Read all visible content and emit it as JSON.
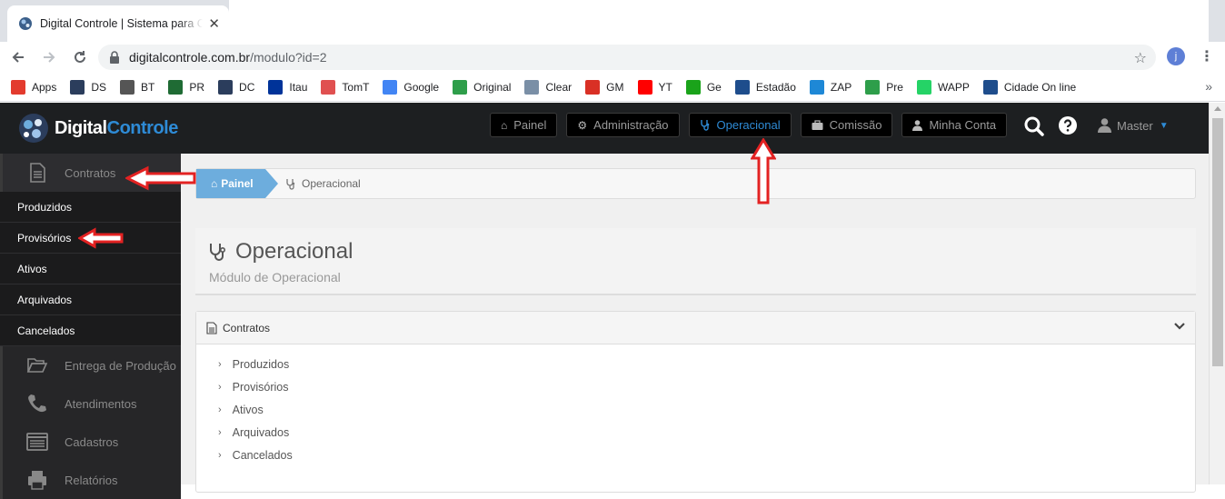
{
  "browser": {
    "tab_title": "Digital Controle | Sistema para Co",
    "tab_close": "✕",
    "url_host": "digitalcontrole.com.br",
    "url_path": "/modulo?id=2",
    "profile_initial": "j",
    "bookmarks": [
      {
        "label": "Apps",
        "icon": "apps-grid-icon",
        "color": "#e33b2e"
      },
      {
        "label": "DS",
        "icon": "ds-icon",
        "color": "#2b3d5c"
      },
      {
        "label": "BT",
        "icon": "bt-icon",
        "color": "#555555"
      },
      {
        "label": "PR",
        "icon": "pr-icon",
        "color": "#1f6b34"
      },
      {
        "label": "DC",
        "icon": "dc-icon",
        "color": "#2b3d5c"
      },
      {
        "label": "Itau",
        "icon": "itau-icon",
        "color": "#003399"
      },
      {
        "label": "TomT",
        "icon": "tomt-icon",
        "color": "#e05050"
      },
      {
        "label": "Google",
        "icon": "google-icon",
        "color": "#4285f4"
      },
      {
        "label": "Original",
        "icon": "original-icon",
        "color": "#2e9e4a"
      },
      {
        "label": "Clear",
        "icon": "clear-icon",
        "color": "#7a8fa6"
      },
      {
        "label": "GM",
        "icon": "gmail-icon",
        "color": "#d93025"
      },
      {
        "label": "YT",
        "icon": "youtube-icon",
        "color": "#ff0000"
      },
      {
        "label": "Ge",
        "icon": "ge-icon",
        "color": "#1aa31a"
      },
      {
        "label": "Estadão",
        "icon": "estadao-icon",
        "color": "#1e4d8c"
      },
      {
        "label": "ZAP",
        "icon": "zap-icon",
        "color": "#1e88d6"
      },
      {
        "label": "Pre",
        "icon": "pre-icon",
        "color": "#2e9e4a"
      },
      {
        "label": "WAPP",
        "icon": "whatsapp-icon",
        "color": "#25d366"
      },
      {
        "label": "Cidade On line",
        "icon": "cidade-icon",
        "color": "#1e4d8c"
      }
    ]
  },
  "app": {
    "logo_part1": "Digital",
    "logo_part2": "Controle",
    "nav": [
      {
        "label": "Painel",
        "icon": "home-icon",
        "active": false
      },
      {
        "label": "Administração",
        "icon": "gears-icon",
        "active": false
      },
      {
        "label": "Operacional",
        "icon": "stethoscope-icon",
        "active": true
      },
      {
        "label": "Comissão",
        "icon": "briefcase-icon",
        "active": false
      },
      {
        "label": "Minha Conta",
        "icon": "user-icon",
        "active": false
      }
    ],
    "user_name": "Master",
    "accent_color": "#2e8bd6"
  },
  "sidebar": {
    "contratos": "Contratos",
    "sub_items": [
      "Produzidos",
      "Provisórios",
      "Ativos",
      "Arquivados",
      "Cancelados"
    ],
    "entrega": "Entrega de Produção",
    "atendimentos": "Atendimentos",
    "cadastros": "Cadastros",
    "relatorios": "Relatórios"
  },
  "breadcrumb": {
    "home": "Painel",
    "current": "Operacional"
  },
  "page": {
    "title": "Operacional",
    "subtitle": "Módulo de Operacional"
  },
  "panel": {
    "title": "Contratos",
    "items": [
      "Produzidos",
      "Provisórios",
      "Ativos",
      "Arquivados",
      "Cancelados"
    ]
  }
}
